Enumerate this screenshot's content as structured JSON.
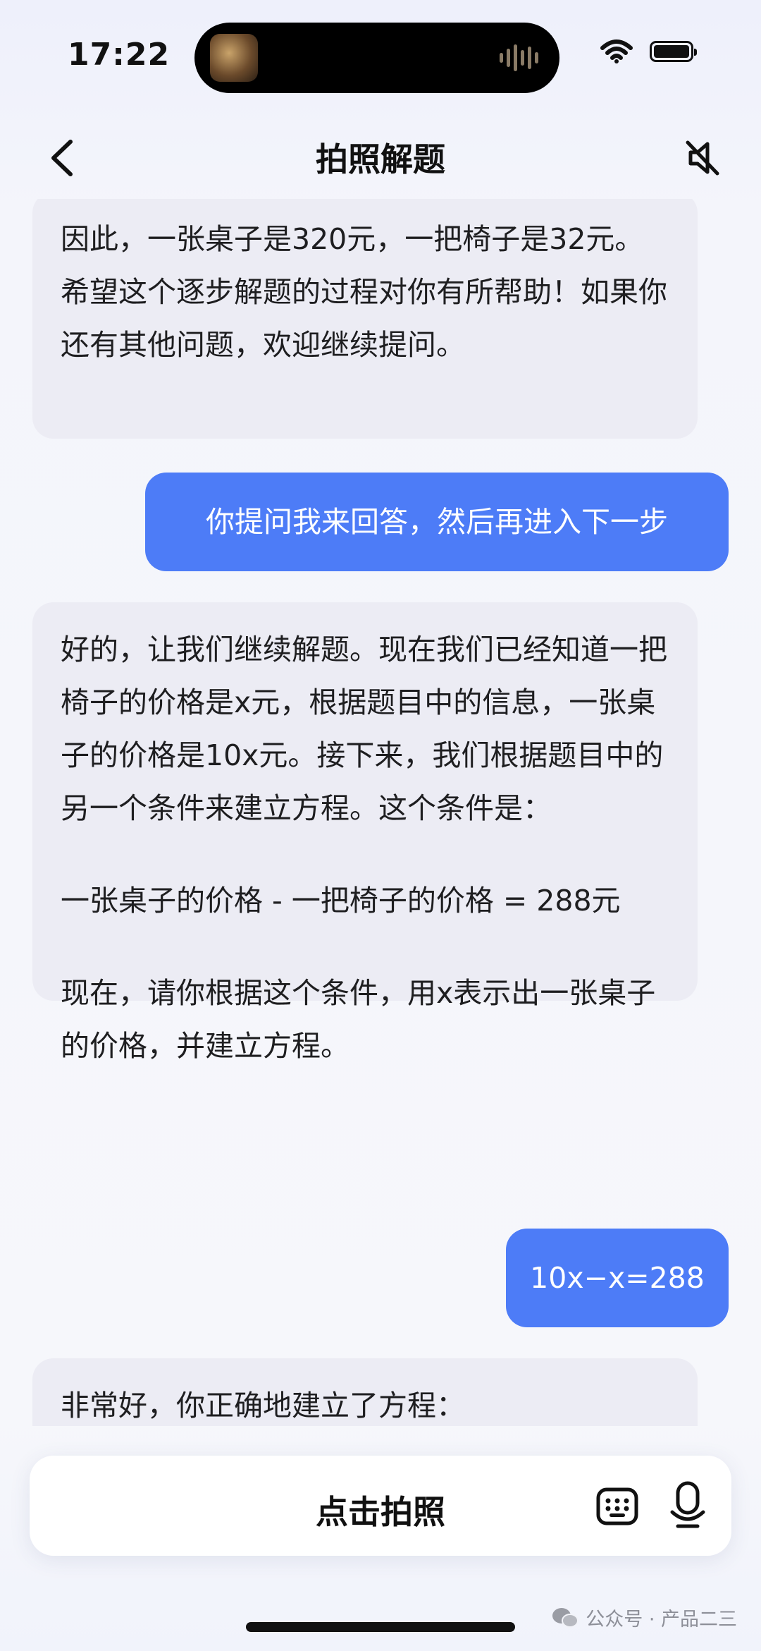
{
  "status_bar": {
    "time": "17:22"
  },
  "nav": {
    "title": "拍照解题"
  },
  "messages": [
    {
      "role": "assistant",
      "paragraphs": [
        "因此，一张桌子是320元，一把椅子是32元。希望这个逐步解题的过程对你有所帮助！如果你还有其他问题，欢迎继续提问。"
      ]
    },
    {
      "role": "user",
      "text": "你提问我来回答，然后再进入下一步"
    },
    {
      "role": "assistant",
      "paragraphs": [
        "好的，让我们继续解题。现在我们已经知道一把椅子的价格是x元，根据题目中的信息，一张桌子的价格是10x元。接下来，我们根据题目中的另一个条件来建立方程。这个条件是：",
        "一张桌子的价格 - 一把椅子的价格 = 288元",
        "现在，请你根据这个条件，用x表示出一张桌子的价格，并建立方程。"
      ]
    },
    {
      "role": "user",
      "text": "10x−x=288"
    },
    {
      "role": "assistant",
      "paragraphs": [
        "非常好，你正确地建立了方程："
      ]
    }
  ],
  "input_bar": {
    "photo_label": "点击拍照"
  },
  "icons": {
    "back": "chevron-left-icon",
    "mute": "speaker-muted-icon",
    "keyboard": "keyboard-icon",
    "mic": "microphone-icon",
    "wifi": "wifi-icon",
    "battery": "battery-icon",
    "wechat": "wechat-icon"
  },
  "watermark": "公众号 · 产品二三",
  "colors": {
    "user_bubble": "#4d7cf7",
    "assistant_bubble": "#ececf4"
  }
}
